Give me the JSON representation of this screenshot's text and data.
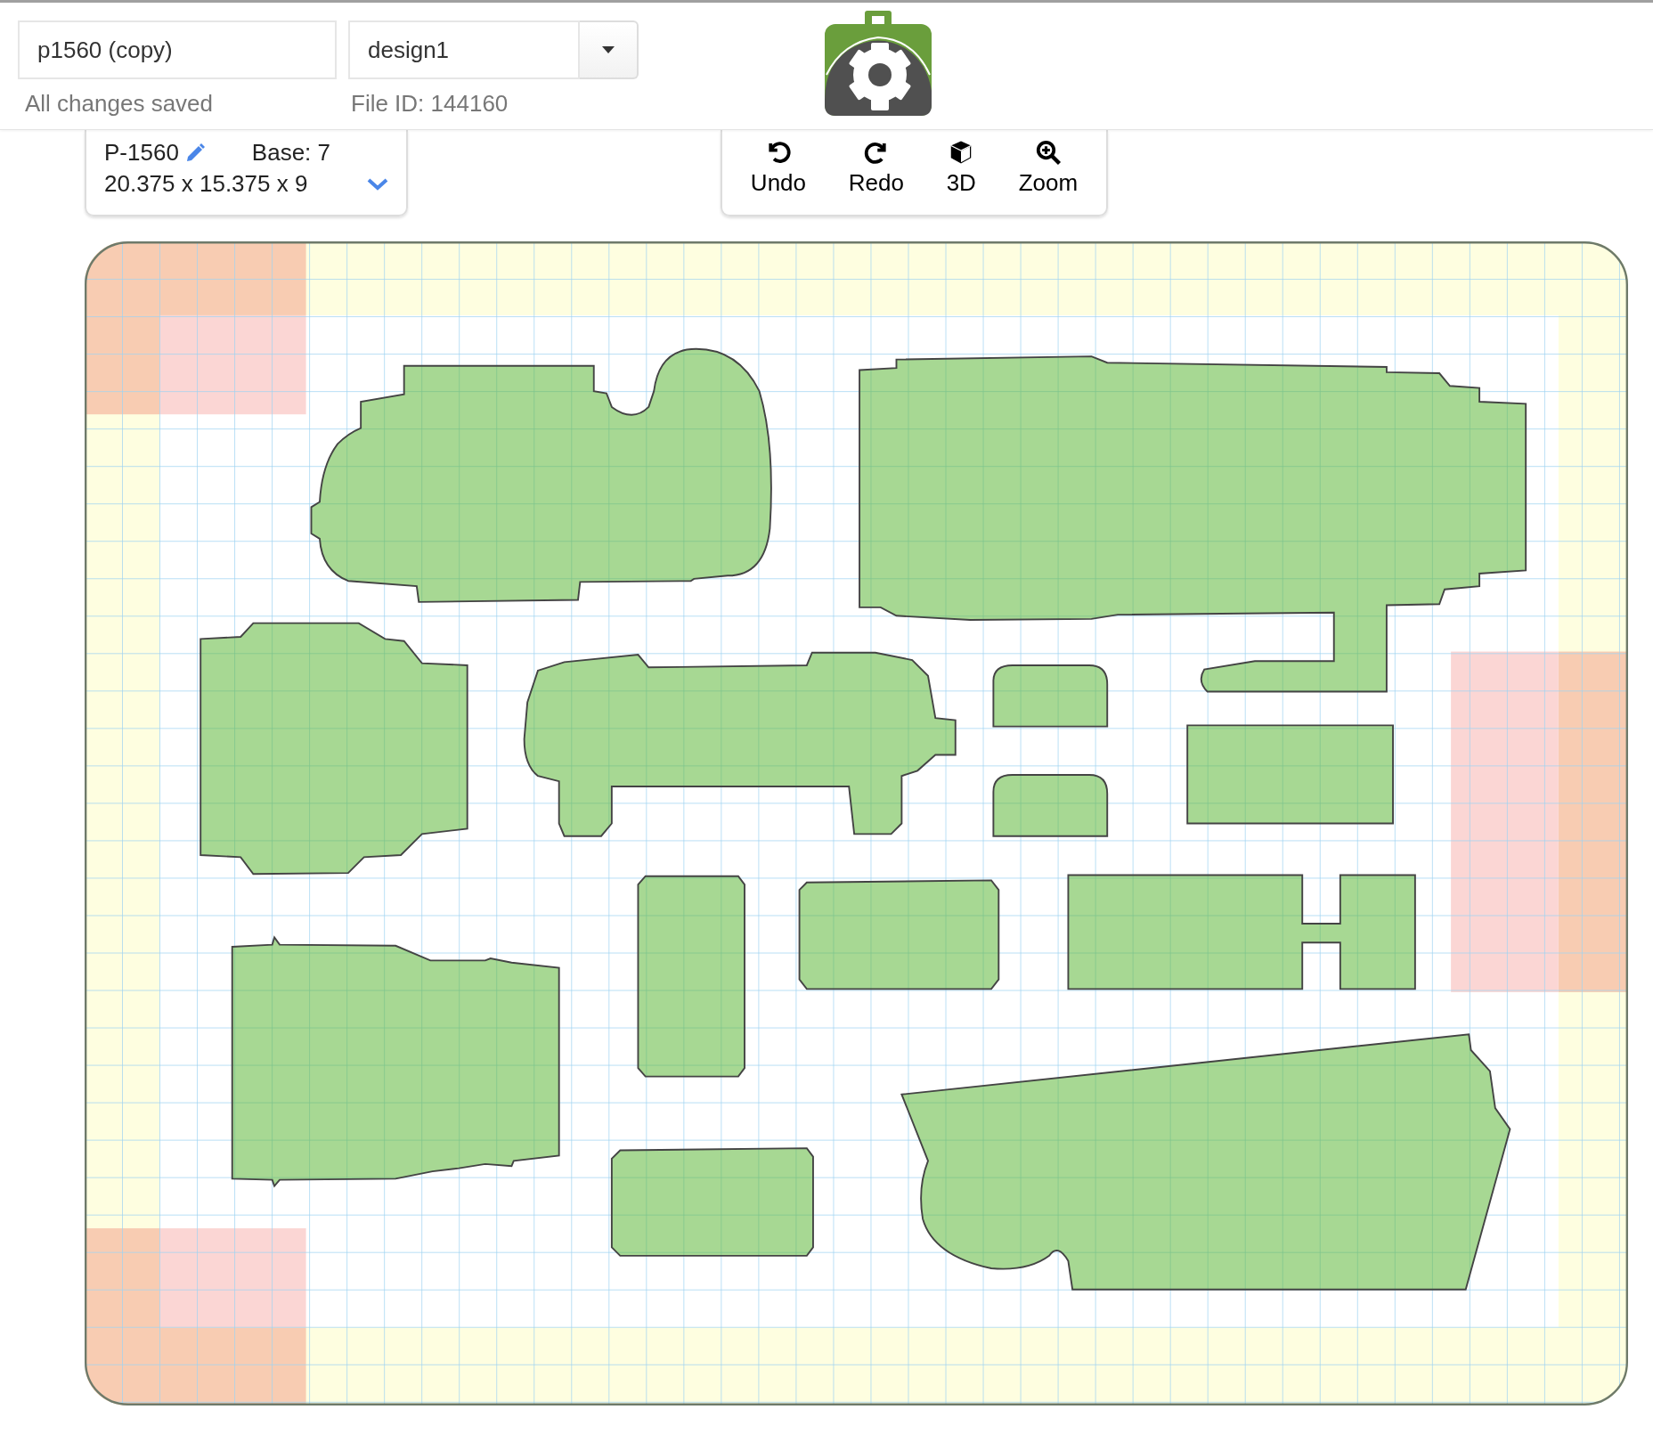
{
  "header": {
    "file_name": {
      "value": "p1560 (copy)"
    },
    "design": {
      "value": "design1"
    },
    "save_status": "All changes saved",
    "file_id": "File ID: 144160"
  },
  "info_panel": {
    "part_number": "P-1560",
    "base": "Base: 7",
    "dimensions": "20.375 x 15.375 x 9"
  },
  "toolbar": [
    {
      "label": "Undo",
      "kind": "undo"
    },
    {
      "label": "Redo",
      "kind": "redo"
    },
    {
      "label": "3D",
      "kind": "cube"
    },
    {
      "label": "Zoom",
      "kind": "zoom"
    }
  ]
}
